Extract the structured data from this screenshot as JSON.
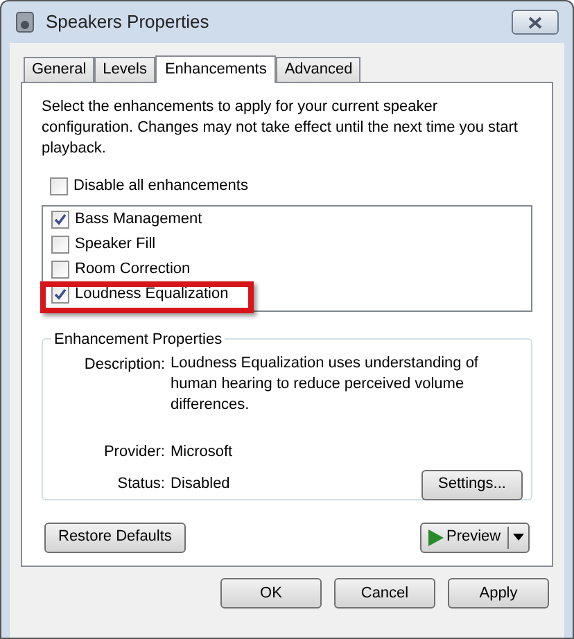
{
  "window": {
    "title": "Speakers Properties"
  },
  "tabs": [
    {
      "label": "General",
      "selected": false
    },
    {
      "label": "Levels",
      "selected": false
    },
    {
      "label": "Enhancements",
      "selected": true
    },
    {
      "label": "Advanced",
      "selected": false
    }
  ],
  "intro": "Select the enhancements to apply for your current speaker configuration. Changes may not take effect until the next time you start playback.",
  "disable_all": {
    "label": "Disable all enhancements",
    "checked": false
  },
  "enhancements": [
    {
      "label": "Bass Management",
      "checked": true,
      "highlighted": false
    },
    {
      "label": "Speaker Fill",
      "checked": false,
      "highlighted": false
    },
    {
      "label": "Room Correction",
      "checked": false,
      "highlighted": false
    },
    {
      "label": "Loudness Equalization",
      "checked": true,
      "highlighted": true
    }
  ],
  "properties": {
    "title": "Enhancement Properties",
    "description_label": "Description:",
    "description": "Loudness Equalization uses understanding of human hearing to reduce perceived volume differences.",
    "provider_label": "Provider:",
    "provider": "Microsoft",
    "status_label": "Status:",
    "status": "Disabled",
    "settings_button": "Settings..."
  },
  "restore_button": "Restore Defaults",
  "preview_button": "Preview",
  "buttons": [
    "OK",
    "Cancel",
    "Apply"
  ]
}
